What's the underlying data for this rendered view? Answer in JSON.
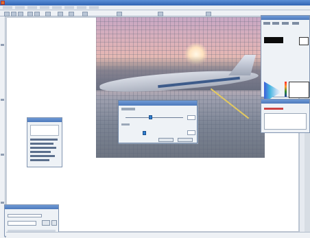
{
  "window": {
    "title": "",
    "icon": "app-icon"
  },
  "menubar": {
    "items": [
      "",
      "",
      "",
      "",
      "",
      "",
      "",
      ""
    ]
  },
  "toolbar": {
    "buttons": [
      "tool",
      "tool",
      "tool",
      "tool",
      "tool",
      "tool",
      "tool",
      "tool",
      "tool",
      "tool",
      "tool",
      "tool"
    ]
  },
  "image": {
    "name": "airport-sunset-photo"
  },
  "adjust_dialog": {
    "title": "",
    "slider1_label": "",
    "slider2_label": "",
    "ok_label": "",
    "cancel_label": ""
  },
  "colors": {
    "accent": "#4d79bb",
    "panel_bg": "#eef2f6",
    "window_bg": "#d7dde4"
  }
}
